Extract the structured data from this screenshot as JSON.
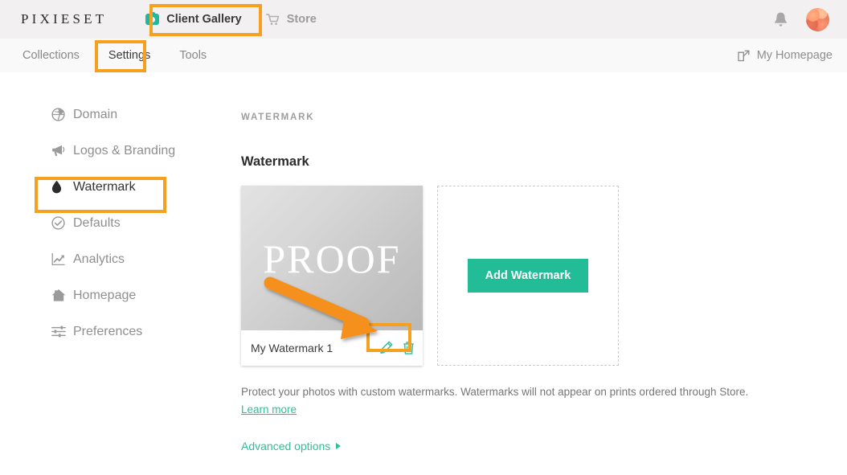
{
  "brand": {
    "logo": "PIXIESET"
  },
  "header": {
    "nav": [
      {
        "label": "Client Gallery",
        "icon": "camera-icon",
        "active": true
      },
      {
        "label": "Store",
        "icon": "cart-icon",
        "active": false
      }
    ],
    "notifications_icon": "bell-icon",
    "avatar": "user-avatar"
  },
  "subnav": {
    "items": [
      {
        "label": "Collections",
        "active": false
      },
      {
        "label": "Settings",
        "active": true
      },
      {
        "label": "Tools",
        "active": false
      }
    ],
    "right_link": {
      "label": "My Homepage",
      "icon": "external-link-icon"
    }
  },
  "sidebar": {
    "items": [
      {
        "label": "Domain",
        "icon": "globe-icon",
        "active": false
      },
      {
        "label": "Logos & Branding",
        "icon": "megaphone-icon",
        "active": false
      },
      {
        "label": "Watermark",
        "icon": "droplet-icon",
        "active": true
      },
      {
        "label": "Defaults",
        "icon": "check-circle-icon",
        "active": false
      },
      {
        "label": "Analytics",
        "icon": "chart-line-icon",
        "active": false
      },
      {
        "label": "Homepage",
        "icon": "home-icon",
        "active": false
      },
      {
        "label": "Preferences",
        "icon": "sliders-icon",
        "active": false
      }
    ]
  },
  "main": {
    "eyebrow": "WATERMARK",
    "section_title": "Watermark",
    "watermark_card": {
      "preview_text": "PROOF",
      "name": "My Watermark 1",
      "edit_icon": "pencil-icon",
      "delete_icon": "trash-icon"
    },
    "add_card": {
      "button_label": "Add Watermark"
    },
    "description": "Protect your photos with custom watermarks. Watermarks will not appear on prints ordered through Store.",
    "learn_more": "Learn more",
    "advanced_options": "Advanced options"
  },
  "colors": {
    "accent_teal": "#22bc96",
    "link_teal": "#2fbd9b",
    "highlight_orange": "#f5a01e",
    "header_bg": "#f2f0f1",
    "subnav_bg": "#f9f9f9",
    "text_dark": "#2b2b2b",
    "text_muted": "#8f8f8f"
  }
}
